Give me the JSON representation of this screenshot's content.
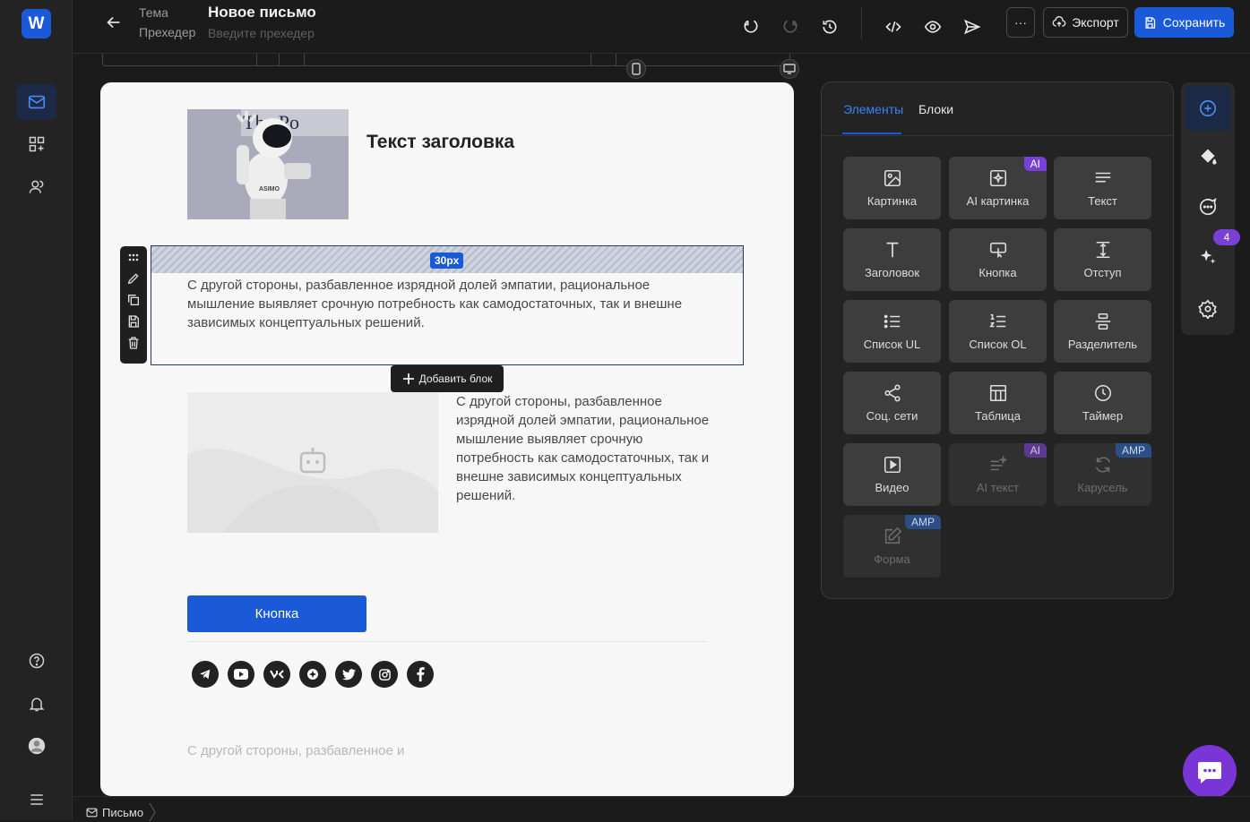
{
  "app": {
    "logo": "W"
  },
  "header": {
    "theme_label": "Тема",
    "title": "Новое письмо",
    "preheader_label": "Прехедер",
    "preheader_placeholder": "Введите прехедер",
    "more_label": "···",
    "export_label": "Экспорт",
    "save_label": "Сохранить"
  },
  "canvas": {
    "heading": "Текст заголовка",
    "spacer_value": "30px",
    "paragraph_1": "С другой стороны, разбавленное изрядной долей эмпатии, рациональное мышление выявляет срочную потребность как самодостаточных, так и внешне зависимых концептуальных решений.",
    "add_block_label": "Добавить блок",
    "paragraph_2": "С другой стороны, разбавленное изрядной долей эмпатии, рациональное мышление выявляет срочную потребность как самодостаточных, так и внешне зависимых концептуальных решений.",
    "button_label": "Кнопка",
    "footer_text": "С другой стороны, разбавленное и",
    "socials": [
      "telegram",
      "youtube",
      "vk",
      "ok",
      "twitter",
      "instagram",
      "facebook"
    ]
  },
  "panel": {
    "tabs": [
      "Элементы",
      "Блоки"
    ],
    "tiles": [
      {
        "label": "Картинка",
        "icon": "image-icon"
      },
      {
        "label": "AI картинка",
        "icon": "ai-image-icon",
        "badge": "AI"
      },
      {
        "label": "Текст",
        "icon": "text-icon"
      },
      {
        "label": "Заголовок",
        "icon": "heading-icon"
      },
      {
        "label": "Кнопка",
        "icon": "button-icon"
      },
      {
        "label": "Отступ",
        "icon": "spacer-icon"
      },
      {
        "label": "Список UL",
        "icon": "list-ul-icon"
      },
      {
        "label": "Список OL",
        "icon": "list-ol-icon"
      },
      {
        "label": "Разделитель",
        "icon": "divider-icon"
      },
      {
        "label": "Соц. сети",
        "icon": "share-icon"
      },
      {
        "label": "Таблица",
        "icon": "table-icon"
      },
      {
        "label": "Таймер",
        "icon": "timer-icon"
      },
      {
        "label": "Видео",
        "icon": "video-icon"
      },
      {
        "label": "AI текст",
        "icon": "ai-text-icon",
        "badge": "AI",
        "disabled": true
      },
      {
        "label": "Карусель",
        "icon": "carousel-icon",
        "badge": "AMP",
        "disabled": true
      },
      {
        "label": "Форма",
        "icon": "form-icon",
        "badge": "AMP",
        "disabled": true
      }
    ]
  },
  "siderail": {
    "badge_count": "4"
  },
  "footer": {
    "breadcrumb": "Письмо"
  },
  "colors": {
    "accent": "#1a5ad8",
    "ai": "#7a3fd6",
    "amp": "#2c4e86",
    "bg": "#1b1b1b"
  }
}
